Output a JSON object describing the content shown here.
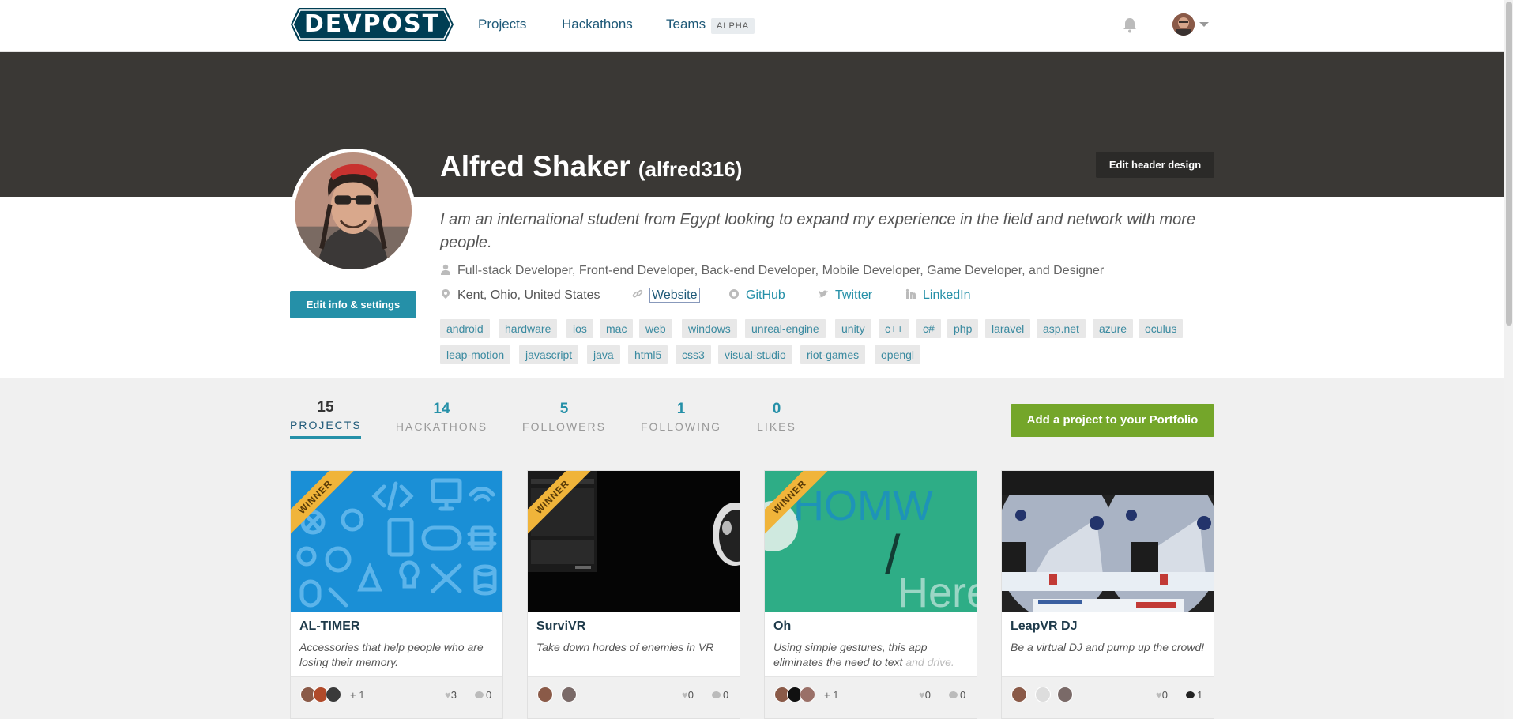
{
  "nav": {
    "logo": "DEVPOST",
    "projects": "Projects",
    "hackathons": "Hackathons",
    "teams": "Teams",
    "alpha": "ALPHA"
  },
  "header": {
    "edit_header_design": "Edit header design"
  },
  "profile": {
    "name": "Alfred Shaker",
    "handle": "(alfred316)",
    "bio": "I am an international student from Egypt looking to expand my experience in the field and network with more people.",
    "roles": "Full-stack Developer, Front-end Developer, Back-end Developer, Mobile Developer, Game Developer, and Designer",
    "location": "Kent, Ohio, United States",
    "website": "Website",
    "github": "GitHub",
    "twitter": "Twitter",
    "linkedin": "LinkedIn",
    "edit_info": "Edit info & settings",
    "tags": [
      "android",
      "hardware",
      "ios",
      "mac",
      "web",
      "windows",
      "unreal-engine",
      "unity",
      "c++",
      "c#",
      "php",
      "laravel",
      "asp.net",
      "azure",
      "oculus",
      "leap-motion",
      "javascript",
      "java",
      "html5",
      "css3",
      "visual-studio",
      "riot-games",
      "opengl"
    ]
  },
  "stats": [
    {
      "num": "15",
      "label": "PROJECTS"
    },
    {
      "num": "14",
      "label": "HACKATHONS"
    },
    {
      "num": "5",
      "label": "FOLLOWERS"
    },
    {
      "num": "1",
      "label": "FOLLOWING"
    },
    {
      "num": "0",
      "label": "LIKES"
    }
  ],
  "add_project": "Add a project to your Portfolio",
  "projects": [
    {
      "title": "AL-TIMER",
      "tagline": "Accessories that help people who are losing their memory.",
      "tagline_fade": "",
      "winner": "WINNER",
      "extra": "+ 1",
      "likes": "3",
      "comments": "0"
    },
    {
      "title": "SurviVR",
      "tagline": "Take down hordes of enemies in VR",
      "tagline_fade": "",
      "winner": "WINNER",
      "extra": "",
      "likes": "0",
      "comments": "0"
    },
    {
      "title": "Oh",
      "tagline": "Using simple gestures, this app eliminates the need to text ",
      "tagline_fade": "and drive.",
      "winner": "WINNER",
      "extra": "+ 1",
      "likes": "0",
      "comments": "0"
    },
    {
      "title": "LeapVR DJ",
      "tagline": "Be a virtual DJ and pump up the crowd!",
      "tagline_fade": "",
      "winner": "",
      "extra": "",
      "likes": "0",
      "comments": "1"
    }
  ],
  "thumb_text": {
    "oh_top": "HOMW",
    "oh_slash": "/",
    "oh_bottom": "Here"
  }
}
